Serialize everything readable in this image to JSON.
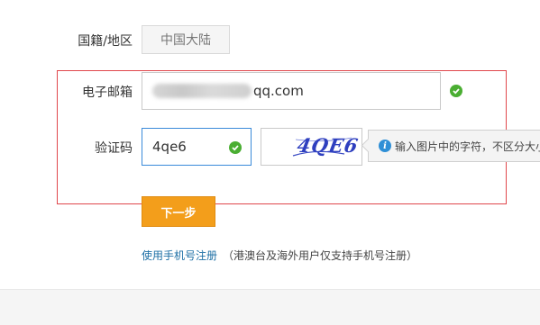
{
  "form": {
    "nationality_label": "国籍/地区",
    "nationality_value": "中国大陆",
    "email_label": "电子邮箱",
    "email_value": "qq.com",
    "captcha_label": "验证码",
    "captcha_value": "4qe6",
    "captcha_image_text": "4QE6",
    "captcha_hint": "输入图片中的字符，不区分大小写",
    "next_button": "下一步",
    "phone_register_link": "使用手机号注册",
    "phone_register_note": "（港澳台及海外用户仅支持手机号注册）"
  },
  "icons": {
    "email_valid": "check-circle-icon",
    "captcha_valid": "check-circle-icon",
    "hint": "info-icon"
  },
  "colors": {
    "accent_button": "#f39e1b",
    "valid_green": "#4aae32",
    "focus_border": "#3a8ad9",
    "highlight_border": "#e0474c",
    "link_blue": "#1d6fa5"
  }
}
